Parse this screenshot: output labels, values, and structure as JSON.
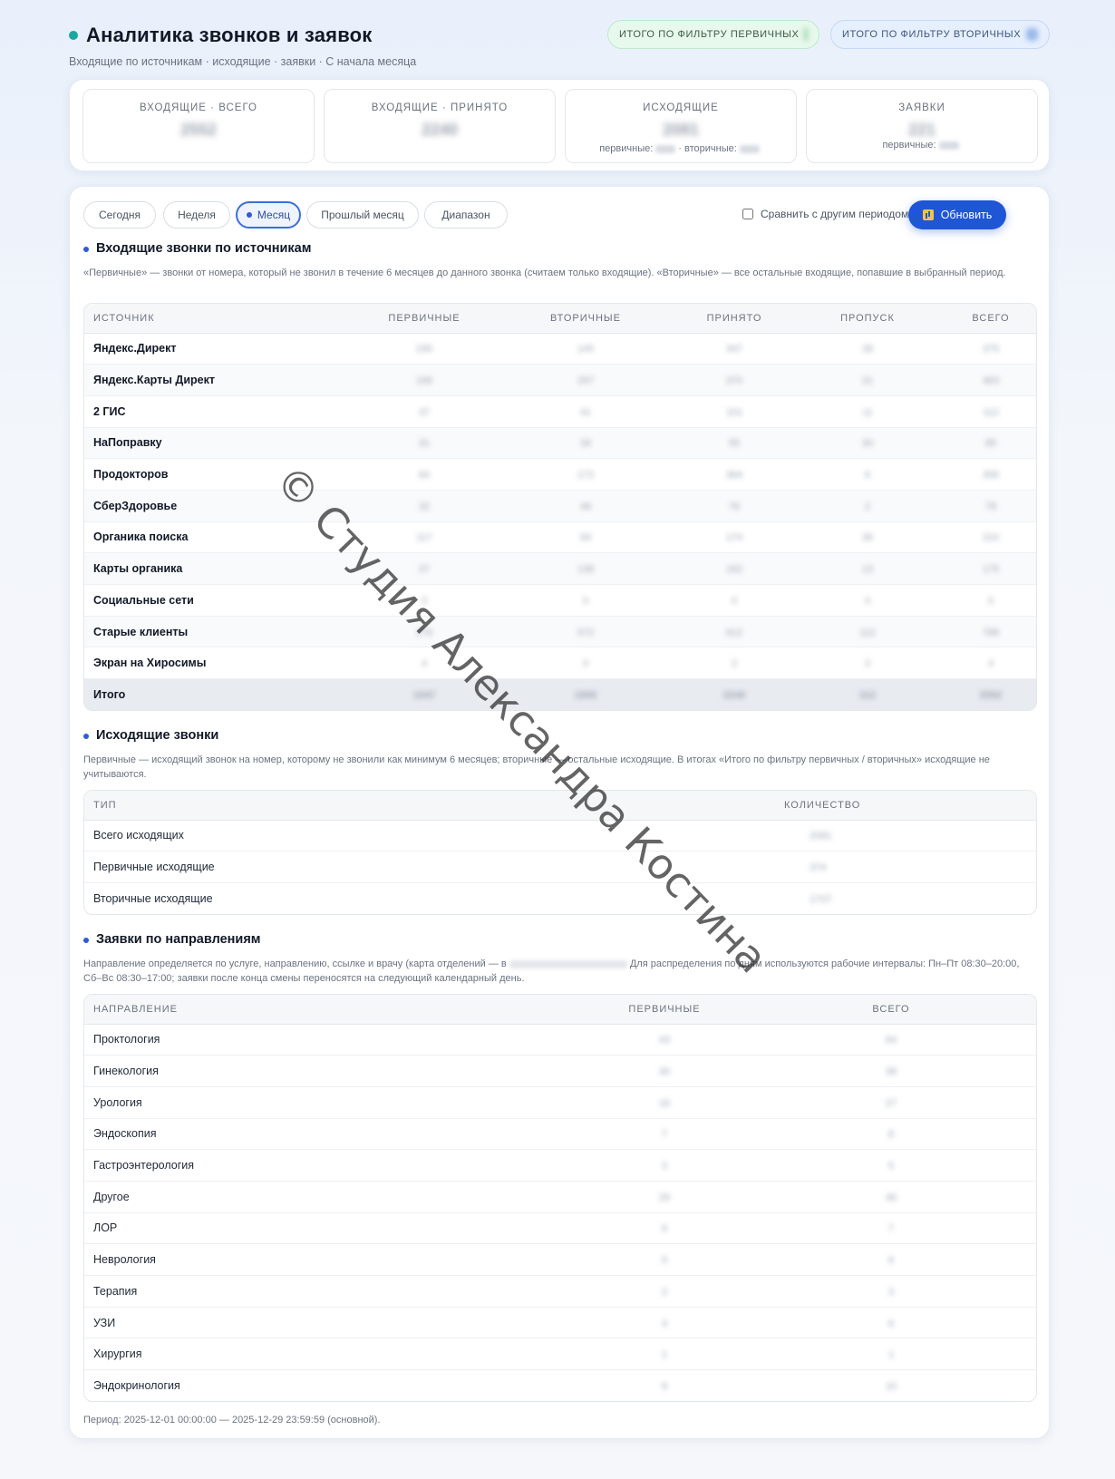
{
  "header": {
    "title": "Аналитика звонков и заявок",
    "subtitle": "Входящие по источникам · исходящие · заявки · С начала месяца",
    "pill_primary": "ИТОГО ПО ФИЛЬТРУ ПЕРВИЧНЫХ",
    "pill_secondary": "ИТОГО ПО ФИЛЬТРУ ВТОРИЧНЫХ"
  },
  "kpis": [
    {
      "label": "ВХОДЯЩИЕ · ВСЕГО",
      "value": "2552",
      "sub": ""
    },
    {
      "label": "ВХОДЯЩИЕ · ПРИНЯТО",
      "value": "2240",
      "sub": ""
    },
    {
      "label": "ИСХОДЯЩИЕ",
      "value": "2081",
      "sub_primary": "первичные:",
      "sub_secondary": "· вторичные:"
    },
    {
      "label": "ЗАЯВКИ",
      "value": "221",
      "sub_primary": "первичные:"
    }
  ],
  "toolbar": {
    "periods": [
      "Сегодня",
      "Неделя",
      "Месяц",
      "Прошлый месяц",
      "Диапазон"
    ],
    "active_period": "Месяц",
    "compare_label": "Сравнить с другим периодом",
    "refresh_label": "Обновить"
  },
  "incoming": {
    "title": "Входящие звонки по источникам",
    "description": "«Первичные» — звонки от номера, который не звонил в течение 6 месяцев до данного звонка (считаем только входящие). «Вторичные» — все остальные входящие, попавшие в выбранный период.",
    "columns": [
      "ИСТОЧНИК",
      "ПЕРВИЧНЫЕ",
      "ВТОРИЧНЫЕ",
      "ПРИНЯТО",
      "ПРОПУСК",
      "ВСЕГО"
    ],
    "rows": [
      {
        "source": "Яндекс.Директ",
        "values": [
          "230",
          "145",
          "347",
          "28",
          "375"
        ]
      },
      {
        "source": "Яндекс.Карты Директ",
        "values": [
          "166",
          "297",
          "370",
          "31",
          "463"
        ]
      },
      {
        "source": "2 ГИС",
        "values": [
          "37",
          "41",
          "101",
          "11",
          "112"
        ]
      },
      {
        "source": "НаПоправку",
        "values": [
          "31",
          "34",
          "55",
          "30",
          "85"
        ]
      },
      {
        "source": "Продокторов",
        "values": [
          "84",
          "172",
          "364",
          "6",
          "356"
        ]
      },
      {
        "source": "СберЗдоровье",
        "values": [
          "32",
          "48",
          "76",
          "2",
          "78"
        ]
      },
      {
        "source": "Органика поиска",
        "values": [
          "117",
          "93",
          "174",
          "36",
          "210"
        ]
      },
      {
        "source": "Карты органика",
        "values": [
          "37",
          "138",
          "162",
          "13",
          "175"
        ]
      },
      {
        "source": "Социальные сети",
        "values": [
          "0",
          "0",
          "0",
          "0",
          "0"
        ]
      },
      {
        "source": "Старые клиенты",
        "values": [
          "276",
          "572",
          "612",
          "112",
          "788"
        ]
      },
      {
        "source": "Экран на Хиросимы",
        "values": [
          "4",
          "0",
          "2",
          "2",
          "4"
        ]
      }
    ],
    "total": {
      "label": "Итого",
      "values": [
        "1047",
        "1505",
        "2240",
        "312",
        "2552"
      ]
    }
  },
  "outgoing": {
    "title": "Исходящие звонки",
    "description": "Первичные — исходящий звонок на номер, которому не звонили как минимум 6 месяцев; вторичные — остальные исходящие. В итогах «Итого по фильтру первичных / вторичных» исходящие не учитываются.",
    "columns": [
      "ТИП",
      "КОЛИЧЕСТВО"
    ],
    "rows": [
      {
        "type": "Всего исходящих",
        "value": "2081"
      },
      {
        "type": "Первичные исходящие",
        "value": "374"
      },
      {
        "type": "Вторичные исходящие",
        "value": "1707"
      }
    ]
  },
  "requests": {
    "title": "Заявки по направлениям",
    "description_start": "Направление определяется по услуге, направлению, ссылке и врачу (карта отделений — в",
    "description_end": "Для распределения по дням используются рабочие интервалы: Пн–Пт 08:30–20:00, Сб–Вс 08:30–17:00; заявки после конца смены переносятся на следующий календарный день.",
    "columns": [
      "НАПРАВЛЕНИЕ",
      "ПЕРВИЧНЫЕ",
      "ВСЕГО"
    ],
    "rows": [
      {
        "direction": "Проктология",
        "primary": "43",
        "total": "64"
      },
      {
        "direction": "Гинекология",
        "primary": "30",
        "total": "38"
      },
      {
        "direction": "Урология",
        "primary": "16",
        "total": "27"
      },
      {
        "direction": "Эндоскопия",
        "primary": "7",
        "total": "8"
      },
      {
        "direction": "Гастроэнтерология",
        "primary": "3",
        "total": "5"
      },
      {
        "direction": "Другое",
        "primary": "29",
        "total": "46"
      },
      {
        "direction": "ЛОР",
        "primary": "6",
        "total": "7"
      },
      {
        "direction": "Неврология",
        "primary": "5",
        "total": "6"
      },
      {
        "direction": "Терапия",
        "primary": "2",
        "total": "3"
      },
      {
        "direction": "УЗИ",
        "primary": "4",
        "total": "6"
      },
      {
        "direction": "Хирургия",
        "primary": "1",
        "total": "1"
      },
      {
        "direction": "Эндокринология",
        "primary": "8",
        "total": "10"
      }
    ]
  },
  "footer": {
    "period": "Период: 2025-12-01 00:00:00 — 2025-12-29 23:59:59 (основной)."
  },
  "watermark": "© Студия Александра Костина"
}
